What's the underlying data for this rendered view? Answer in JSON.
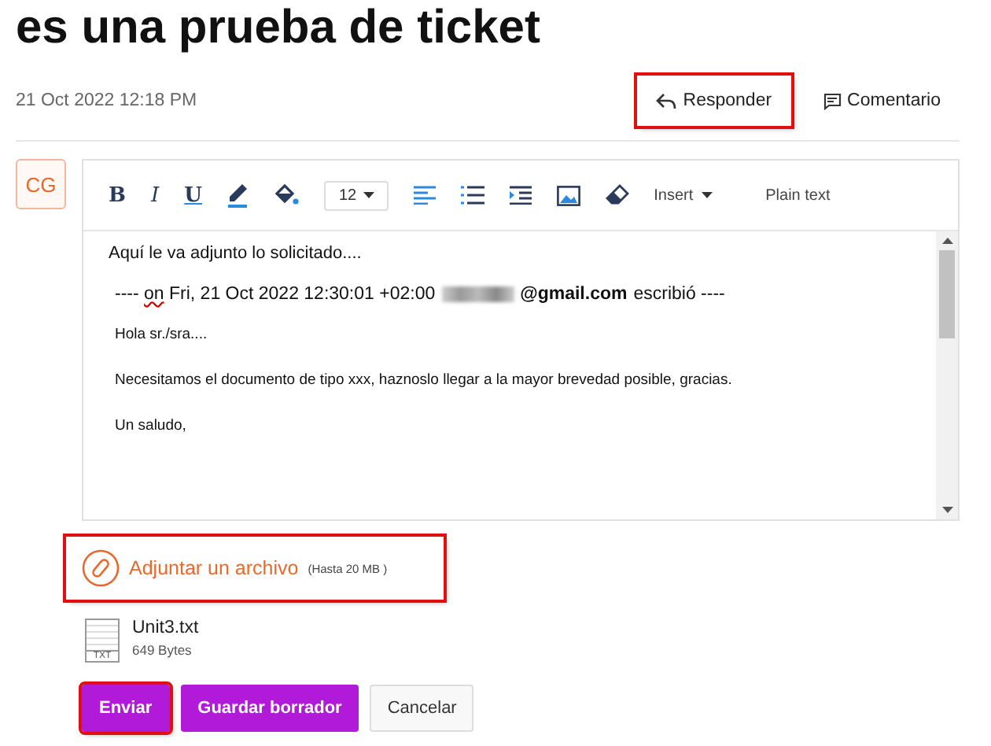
{
  "title": "es una prueba de ticket",
  "date": "21 Oct 2022 12:18 PM",
  "actions": [
    {
      "kind": "reply",
      "label": "Responder",
      "highlighted": true
    },
    {
      "kind": "comment",
      "label": "Comentario",
      "highlighted": false
    }
  ],
  "avatar": "CG",
  "toolbar": [
    {
      "kind": "bold",
      "label": "B"
    },
    {
      "kind": "italic",
      "label": "I"
    },
    {
      "kind": "underline",
      "label": "U"
    },
    {
      "kind": "pen"
    },
    {
      "kind": "fill"
    },
    {
      "kind": "size",
      "label": "12"
    },
    {
      "kind": "align"
    },
    {
      "kind": "list"
    },
    {
      "kind": "indent"
    },
    {
      "kind": "image"
    },
    {
      "kind": "eraser"
    },
    {
      "kind": "insert",
      "label": "Insert"
    },
    {
      "kind": "plain",
      "label": "Plain text"
    }
  ],
  "body": {
    "first_line": "Aquí le va adjunto lo solicitado....",
    "quote_header": {
      "prefix": "---- ",
      "on": "on",
      "middle": " Fri, 21 Oct 2022 12:30:01 +02:00",
      "email": "@gmail.com",
      "suffix": "escribió ----"
    },
    "lines": [
      "Hola sr./sra....",
      "Necesitamos el documento de tipo xxx, haznoslo llegar a la mayor brevedad posible, gracias.",
      "Un saludo,"
    ]
  },
  "attach": {
    "label": "Adjuntar un archivo",
    "limit": "(Hasta 20 MB )",
    "highlighted": true
  },
  "file": {
    "type": "TXT",
    "name": "Unit3.txt",
    "size": "649 Bytes"
  },
  "buttons": [
    {
      "kind": "primary",
      "label": "Enviar",
      "highlighted": true
    },
    {
      "kind": "primary",
      "label": "Guardar borrador",
      "highlighted": false
    },
    {
      "kind": "secondary",
      "label": "Cancelar",
      "highlighted": false
    }
  ]
}
